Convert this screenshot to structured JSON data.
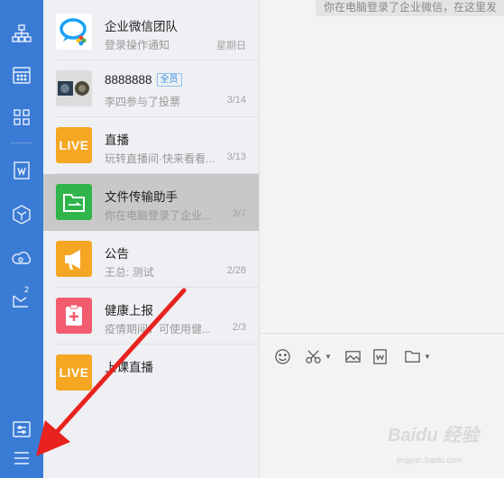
{
  "sidebar": {
    "items": [
      {
        "icon": "org-chart-icon"
      },
      {
        "icon": "calendar-icon"
      },
      {
        "icon": "apps-grid-icon"
      },
      {
        "icon": "document-w-icon"
      },
      {
        "icon": "cube-icon"
      },
      {
        "icon": "cloud-disk-icon"
      },
      {
        "icon": "mail-icon",
        "badge": "2"
      }
    ],
    "bottom": [
      {
        "icon": "settings-sliders-icon"
      },
      {
        "icon": "menu-icon"
      }
    ]
  },
  "conversations": [
    {
      "name": "企业微信团队",
      "preview": "登录操作通知",
      "time": "星期日",
      "avatar": "wecom-logo"
    },
    {
      "name": "8888888",
      "badge": "全员",
      "preview": "李四参与了投票",
      "time": "3/14",
      "avatar": "group-photo"
    },
    {
      "name": "直播",
      "preview": "玩转直播间·快来看看...",
      "time": "3/13",
      "avatar": "live",
      "avatar_text": "LIVE"
    },
    {
      "name": "文件传输助手",
      "preview": "你在电脑登录了企业...",
      "time": "3/7",
      "avatar": "folder",
      "selected": true
    },
    {
      "name": "公告",
      "preview": "王总: 测试",
      "time": "2/28",
      "avatar": "megaphone"
    },
    {
      "name": "健康上报",
      "preview": "疫情期间，可使用健...",
      "time": "2/3",
      "avatar": "health"
    },
    {
      "name": "上课直播",
      "preview": "",
      "time": "",
      "avatar": "live",
      "avatar_text": "LIVE"
    }
  ],
  "chat": {
    "bubble_text": "你在电脑登录了企业微信，在这里发"
  },
  "toolbar": {
    "items": [
      "emoji-icon",
      "scissors-icon",
      "image-icon",
      "word-doc-icon",
      "folder-icon"
    ]
  },
  "watermark": {
    "text": "Baidu 经验",
    "url": "jingyan.baidu.com"
  },
  "colors": {
    "sidebar": "#3a7bd5",
    "live": "#f5a623",
    "folder": "#2fb54a",
    "megaphone": "#f5a623",
    "health": "#f25c6e",
    "annotation_arrow": "#e8231f"
  }
}
